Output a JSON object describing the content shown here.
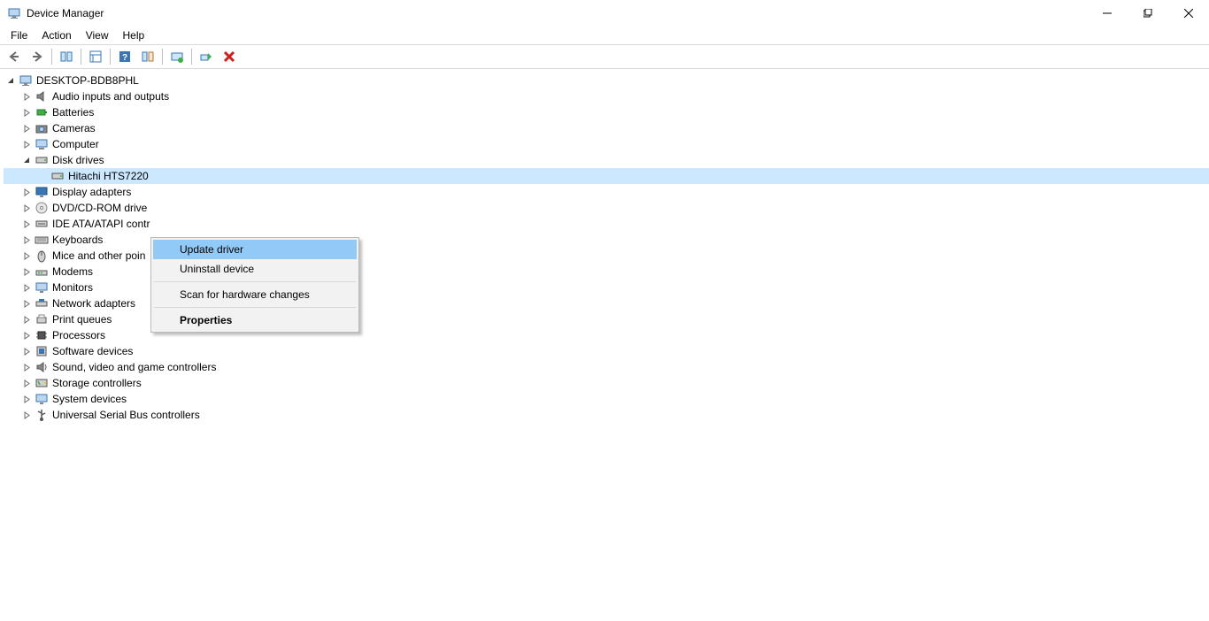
{
  "titlebar": {
    "title": "Device Manager"
  },
  "menubar": {
    "items": [
      "File",
      "Action",
      "View",
      "Help"
    ]
  },
  "tree": {
    "root": "DESKTOP-BDB8PHL",
    "items": [
      {
        "label": "Audio inputs and outputs",
        "icon": "audio"
      },
      {
        "label": "Batteries",
        "icon": "battery"
      },
      {
        "label": "Cameras",
        "icon": "camera"
      },
      {
        "label": "Computer",
        "icon": "computer"
      },
      {
        "label": "Disk drives",
        "icon": "disk",
        "expanded": true,
        "child": "Hitachi HTS7220",
        "childIcon": "disk"
      },
      {
        "label": "Display adapters",
        "icon": "display"
      },
      {
        "label": "DVD/CD-ROM drive",
        "icon": "dvd"
      },
      {
        "label": "IDE ATA/ATAPI contr",
        "icon": "ide"
      },
      {
        "label": "Keyboards",
        "icon": "keyboard"
      },
      {
        "label": "Mice and other poin",
        "icon": "mouse"
      },
      {
        "label": "Modems",
        "icon": "modem"
      },
      {
        "label": "Monitors",
        "icon": "monitor"
      },
      {
        "label": "Network adapters",
        "icon": "network"
      },
      {
        "label": "Print queues",
        "icon": "printer"
      },
      {
        "label": "Processors",
        "icon": "processor"
      },
      {
        "label": "Software devices",
        "icon": "software"
      },
      {
        "label": "Sound, video and game controllers",
        "icon": "sound"
      },
      {
        "label": "Storage controllers",
        "icon": "storage"
      },
      {
        "label": "System devices",
        "icon": "system"
      },
      {
        "label": "Universal Serial Bus controllers",
        "icon": "usb"
      }
    ]
  },
  "context_menu": {
    "update": "Update driver",
    "uninstall": "Uninstall device",
    "scan": "Scan for hardware changes",
    "properties": "Properties"
  }
}
